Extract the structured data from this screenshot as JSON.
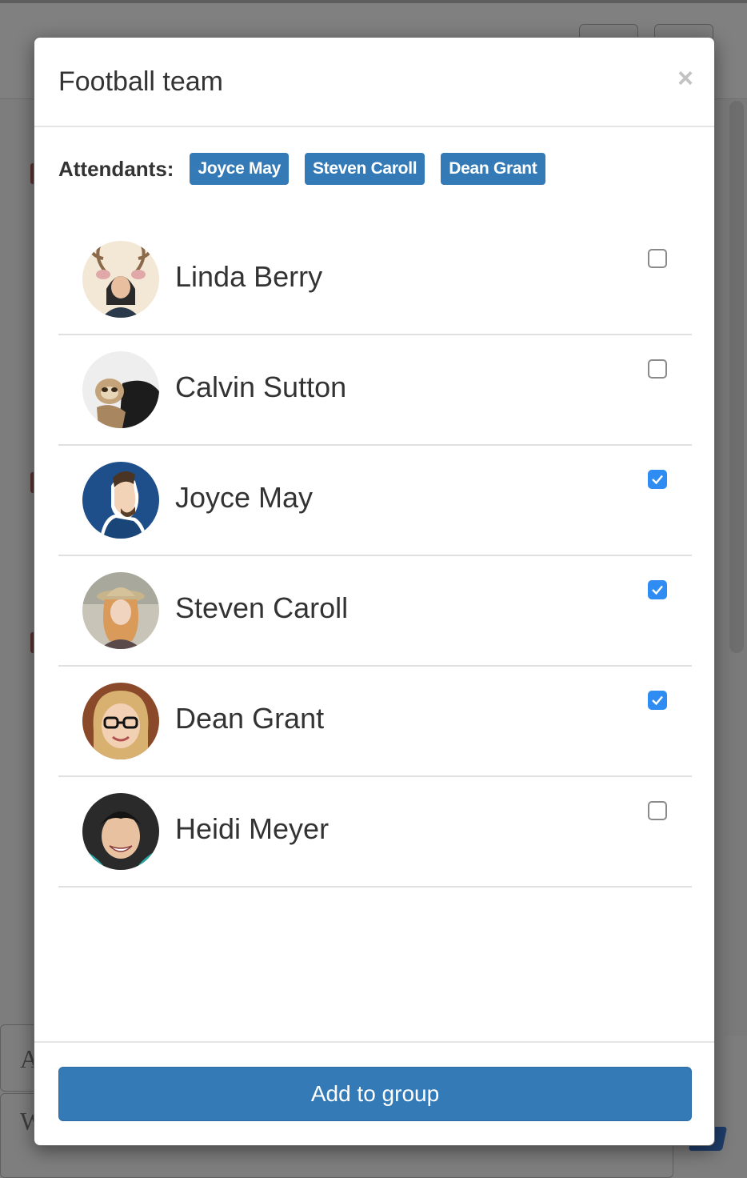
{
  "background": {
    "letters": [
      "A",
      "W"
    ]
  },
  "modal": {
    "title": "Football team",
    "close_label": "×",
    "attendants_label": "Attendants:",
    "attendants": [
      "Joyce May",
      "Steven Caroll",
      "Dean Grant"
    ],
    "members": [
      {
        "name": "Linda Berry",
        "checked": false,
        "avatar": "avatar-antlers-woman"
      },
      {
        "name": "Calvin Sutton",
        "checked": false,
        "avatar": "avatar-sloth"
      },
      {
        "name": "Joyce May",
        "checked": true,
        "avatar": "avatar-illustrated-man"
      },
      {
        "name": "Steven Caroll",
        "checked": true,
        "avatar": "avatar-hat-woman"
      },
      {
        "name": "Dean Grant",
        "checked": true,
        "avatar": "avatar-glasses-woman"
      },
      {
        "name": "Heidi Meyer",
        "checked": false,
        "avatar": "avatar-smiling-woman"
      }
    ],
    "submit_label": "Add to group"
  },
  "colors": {
    "primary": "#337ab7",
    "checkbox_checked": "#2f8cf2",
    "backdrop": "#7d7d7d"
  }
}
